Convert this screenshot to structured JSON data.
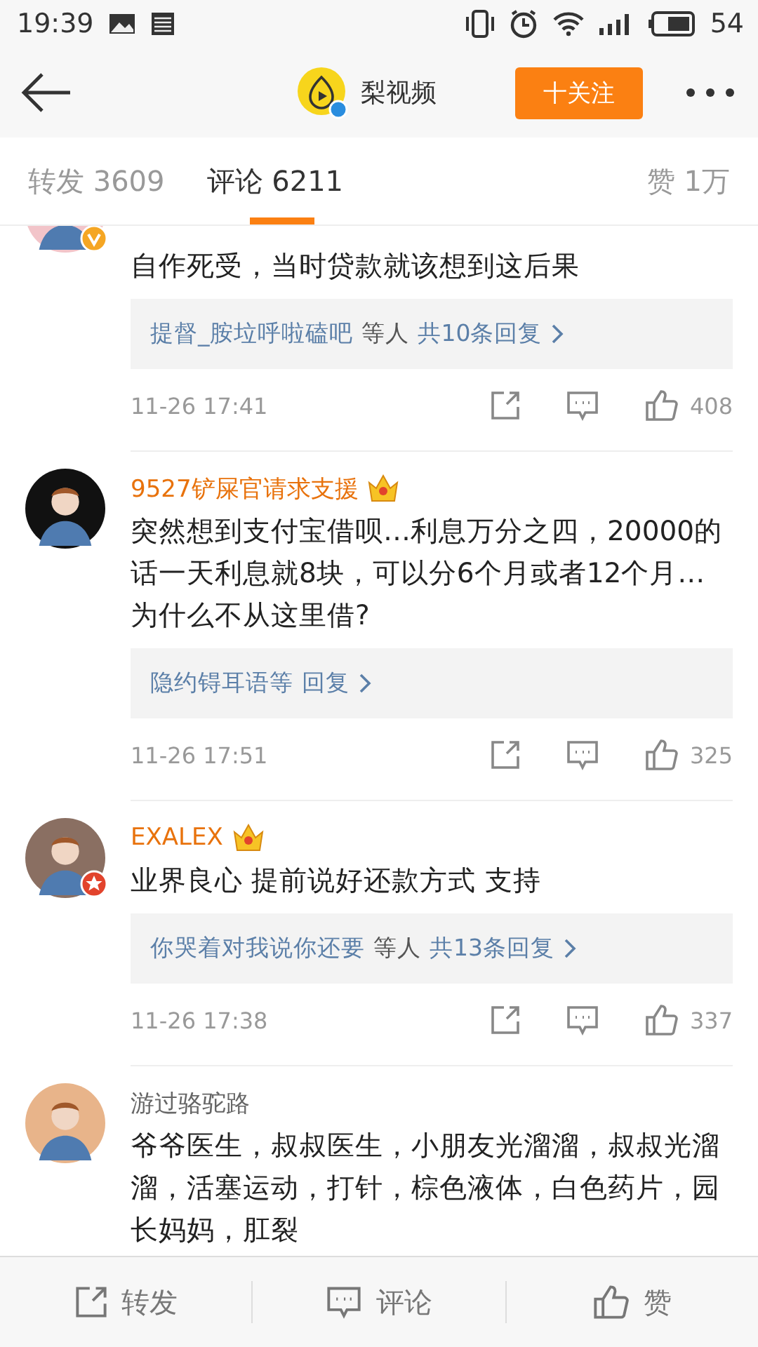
{
  "status_bar": {
    "time": "19:39",
    "battery": "54"
  },
  "header": {
    "account": "梨视频",
    "follow": "十关注"
  },
  "tabs": [
    {
      "label": "转发 3609",
      "selected": false
    },
    {
      "label": "评论 6211",
      "selected": true
    },
    {
      "label": "赞 1万",
      "selected": false
    }
  ],
  "comments": [
    {
      "badge": {
        "kind": "verified"
      },
      "text": "自作死受，当时贷款就该想到这后果",
      "replies": {
        "names": "提督_胺垃呼啦磕吧",
        "suffix": "等人",
        "count": "共10条回复"
      },
      "time": "11-26 17:41",
      "likes": "408"
    },
    {
      "name": "9527铲屎官请求支援",
      "vip": true,
      "text": "突然想到支付宝借呗…利息万分之四，20000的话一天利息就8块，可以分6个月或者12个月…为什么不从这里借?",
      "replies": {
        "names": "隐约锝耳语等",
        "count": "回复"
      },
      "time": "11-26 17:51",
      "likes": "325"
    },
    {
      "badge": {
        "kind": "star"
      },
      "name": "EXALEX",
      "vip": true,
      "text": "业界良心 提前说好还款方式 支持",
      "replies": {
        "names": "你哭着对我说你还要",
        "suffix": "等人",
        "count": "共13条回复"
      },
      "time": "11-26 17:38",
      "likes": "337"
    },
    {
      "name": "游过骆驼路",
      "vip": false,
      "text": "爷爷医生，叔叔医生，小朋友光溜溜，叔叔光溜溜，活塞运动，打针，棕色液体，白色药片，园长妈妈，肛裂"
    }
  ],
  "bottom_bar": [
    {
      "kind": "repost",
      "label": "转发"
    },
    {
      "kind": "comment",
      "label": "评论"
    },
    {
      "kind": "like",
      "label": "赞"
    }
  ]
}
